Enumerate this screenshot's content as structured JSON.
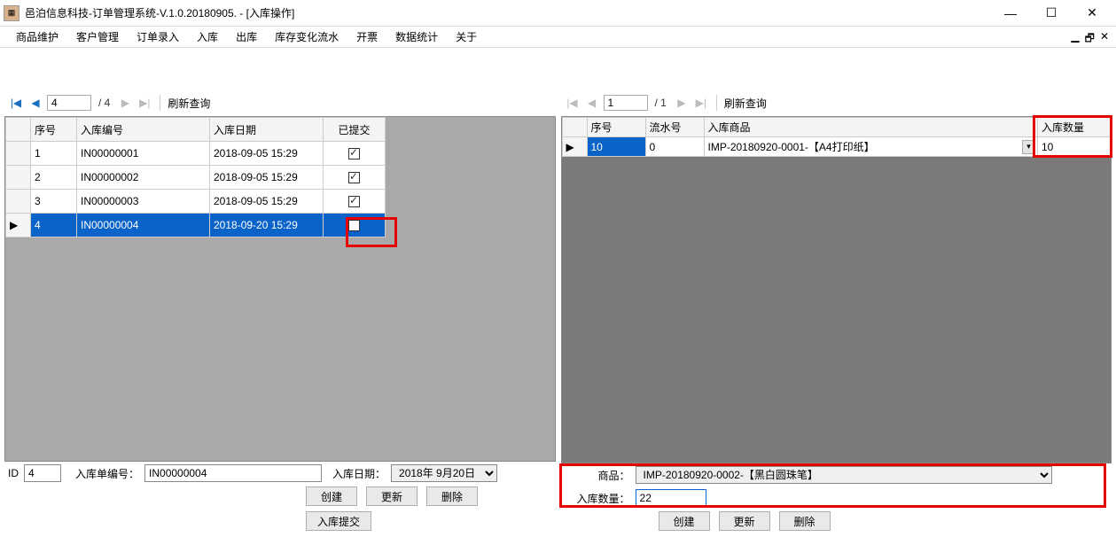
{
  "window": {
    "title": "邑泊信息科技-订单管理系统-V.1.0.20180905. - [入库操作]"
  },
  "menu": [
    "商品维护",
    "客户管理",
    "订单录入",
    "入库",
    "出库",
    "库存变化流水",
    "开票",
    "数据统计",
    "关于"
  ],
  "left": {
    "nav": {
      "page": "4",
      "total": "/ 4",
      "refresh": "刷新查询"
    },
    "headers": [
      "序号",
      "入库编号",
      "入库日期",
      "已提交"
    ],
    "rows": [
      {
        "seq": "1",
        "code": "IN00000001",
        "date": "2018-09-05 15:29",
        "submitted": true,
        "selected": false
      },
      {
        "seq": "2",
        "code": "IN00000002",
        "date": "2018-09-05 15:29",
        "submitted": true,
        "selected": false
      },
      {
        "seq": "3",
        "code": "IN00000003",
        "date": "2018-09-05 15:29",
        "submitted": true,
        "selected": false
      },
      {
        "seq": "4",
        "code": "IN00000004",
        "date": "2018-09-20 15:29",
        "submitted": false,
        "selected": true
      }
    ],
    "form": {
      "id_label": "ID",
      "id": "4",
      "code_label": "入库单编号：",
      "code": "IN00000004",
      "date_label": "入库日期：",
      "date": "2018年 9月20日",
      "btn_create": "创建",
      "btn_update": "更新",
      "btn_delete": "删除",
      "btn_submit": "入库提交"
    }
  },
  "right": {
    "nav": {
      "page": "1",
      "total": "/ 1",
      "refresh": "刷新查询"
    },
    "headers": [
      "序号",
      "流水号",
      "入库商品",
      "入库数量"
    ],
    "rows": [
      {
        "seq": "10",
        "flow": "0",
        "product": "IMP-20180920-0001-【A4打印纸】",
        "qty": "10"
      }
    ],
    "form": {
      "product_label": "商品：",
      "product": "IMP-20180920-0002-【黑白圆珠笔】",
      "qty_label": "入库数量：",
      "qty": "22",
      "btn_create": "创建",
      "btn_update": "更新",
      "btn_delete": "删除"
    }
  }
}
